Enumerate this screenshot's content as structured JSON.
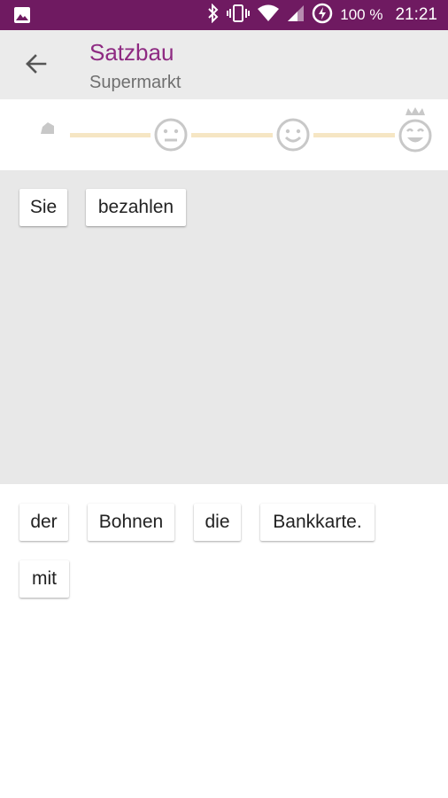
{
  "status_bar": {
    "battery_text": "100 %",
    "time": "21:21",
    "icons": [
      "gallery-icon",
      "bluetooth-icon",
      "vibrate-icon",
      "wifi-icon",
      "signal-icon",
      "battery-saver-icon"
    ]
  },
  "header": {
    "title": "Satzbau",
    "subtitle": "Supermarkt",
    "title_color": "#8e2a82",
    "status_bar_color": "#6f1a61"
  },
  "progress": {
    "stages": [
      "neutral-face-icon",
      "smile-face-icon",
      "crowned-laugh-face-icon"
    ],
    "current_stage": 0
  },
  "answer": {
    "words": [
      "Sie",
      "bezahlen"
    ]
  },
  "pool": {
    "words": [
      "der",
      "Bohnen",
      "die",
      "Bankkarte.",
      "mit"
    ]
  }
}
